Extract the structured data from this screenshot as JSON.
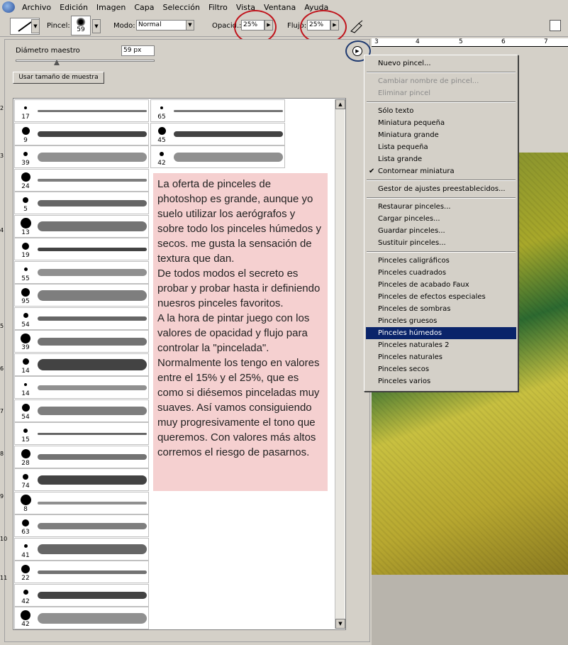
{
  "menubar": [
    "Archivo",
    "Edición",
    "Imagen",
    "Capa",
    "Selección",
    "Filtro",
    "Vista",
    "Ventana",
    "Ayuda"
  ],
  "options": {
    "pincel_label": "Pincel:",
    "pincel_size": "59",
    "modo_label": "Modo:",
    "modo_value": "Normal",
    "opacidad_label": "Opacid.:",
    "opacidad_value": "25%",
    "flujo_label": "Flujo:",
    "flujo_value": "25%"
  },
  "panel": {
    "diametro_label": "Diámetro maestro",
    "diametro_value": "59 px",
    "sample_button": "Usar tamaño de muestra"
  },
  "brushes": {
    "col1": [
      "17",
      "9",
      "39",
      "24",
      "5",
      "13",
      "19",
      "55",
      "95",
      "54",
      "39",
      "14",
      "14",
      "54",
      "15",
      "28",
      "74",
      "8",
      "63",
      "41",
      "22",
      "42",
      "42"
    ],
    "col2": [
      "65",
      "45",
      "42"
    ]
  },
  "ruler": [
    "3",
    "4",
    "5",
    "6",
    "7"
  ],
  "left_ruler": [
    "2",
    "3",
    "4",
    "5",
    "6",
    "7",
    "8",
    "9",
    "10",
    "11"
  ],
  "note_text": "La oferta de pinceles de photoshop es grande, aunque yo suelo utilizar los aerógrafos y sobre todo los pinceles húmedos y secos. me gusta la sensación de textura que dan.\nDe todos modos el secreto es probar y probar hasta ir definiendo nuesros pinceles favoritos.\nA la hora de pintar juego con los valores de opacidad y flujo para controlar la \"pincelada\". Normalmente los tengo en valores entre el 15% y el 25%, que es como si diésemos pinceladas muy suaves. Así vamos consiguiendo muy progresivamente el tono que queremos. Con valores más altos corremos el riesgo de pasarnos.",
  "menu": {
    "group1": [
      {
        "label": "Nuevo pincel..."
      }
    ],
    "group2": [
      {
        "label": "Cambiar nombre de pincel...",
        "disabled": true
      },
      {
        "label": "Eliminar pincel",
        "disabled": true
      }
    ],
    "group3": [
      {
        "label": "Sólo texto"
      },
      {
        "label": "Miniatura pequeña"
      },
      {
        "label": "Miniatura grande"
      },
      {
        "label": "Lista pequeña"
      },
      {
        "label": "Lista grande"
      },
      {
        "label": "Contornear miniatura",
        "checked": true
      }
    ],
    "group4": [
      {
        "label": "Gestor de ajustes preestablecidos..."
      }
    ],
    "group5": [
      {
        "label": "Restaurar pinceles..."
      },
      {
        "label": "Cargar pinceles..."
      },
      {
        "label": "Guardar pinceles..."
      },
      {
        "label": "Sustituir pinceles..."
      }
    ],
    "group6": [
      {
        "label": "Pinceles caligráficos"
      },
      {
        "label": "Pinceles cuadrados"
      },
      {
        "label": "Pinceles de acabado Faux"
      },
      {
        "label": "Pinceles de efectos especiales"
      },
      {
        "label": "Pinceles de sombras"
      },
      {
        "label": "Pinceles gruesos"
      },
      {
        "label": "Pinceles húmedos",
        "selected": true
      },
      {
        "label": "Pinceles naturales 2"
      },
      {
        "label": "Pinceles naturales"
      },
      {
        "label": "Pinceles secos"
      },
      {
        "label": "Pinceles varios"
      }
    ]
  },
  "colors": {
    "menu_highlight": "#0a246a",
    "annotation_circle": "#c0141c",
    "note_bg": "#f5d0d0"
  }
}
